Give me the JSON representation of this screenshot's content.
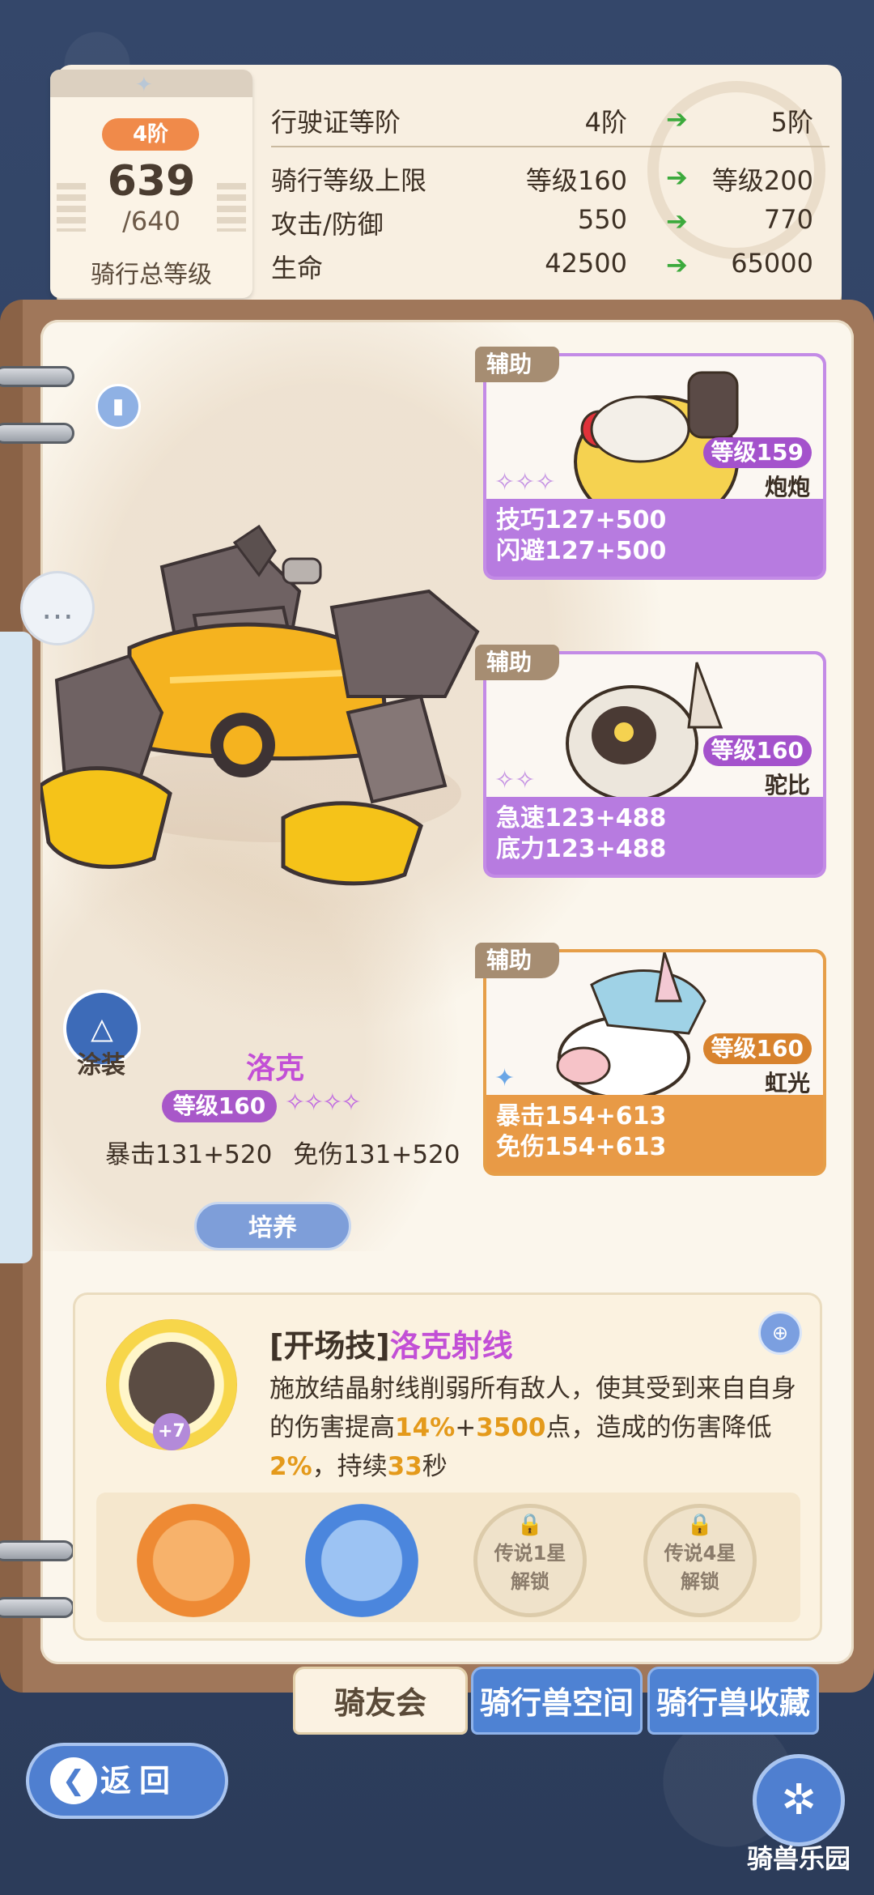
{
  "license": {
    "rank": "4阶",
    "level": "639",
    "level_max": "/640",
    "level_label": "骑行总等级",
    "rows": [
      {
        "label": "行驶证等阶",
        "current": "4阶",
        "next": "5阶"
      },
      {
        "label": "骑行等级上限",
        "current": "等级160",
        "next": "等级200"
      },
      {
        "label": "攻击/防御",
        "current": "550",
        "next": "770"
      },
      {
        "label": "生命",
        "current": "42500",
        "next": "65000"
      }
    ]
  },
  "mount": {
    "name": "洛克",
    "level": "等级160",
    "stars": "✧✧✧✧",
    "stat1": "暴击131+520",
    "stat2": "免伤131+520",
    "train_label": "培养",
    "skin_label": "涂装"
  },
  "support_cards": [
    {
      "tag": "辅助",
      "level": "等级159",
      "name": "炮炮",
      "stars": "✧✧✧",
      "stat1": "技巧127+500",
      "stat2": "闪避127+500",
      "color": "#c38be6"
    },
    {
      "tag": "辅助",
      "level": "等级160",
      "name": "驼比",
      "stars": "✧✧",
      "stat1": "急速123+488",
      "stat2": "底力123+488",
      "color": "#c38be6"
    },
    {
      "tag": "辅助",
      "level": "等级160",
      "name": "虹光",
      "stars": "✦",
      "stat1": "暴击154+613",
      "stat2": "免伤154+613",
      "color": "#e69e48"
    }
  ],
  "skill": {
    "type": "[开场技]",
    "name": "洛克射线",
    "plus": "+7",
    "desc_1": "施放结晶射线削弱所有敌人，使其受到来自自身的伤害提高",
    "desc_pct": "14%",
    "desc_plus": "+",
    "desc_pts": "3500",
    "desc_2": "点，造成的伤害降低",
    "desc_red": "2%",
    "desc_3": "，持续",
    "desc_dur": "33",
    "desc_4": "秒",
    "slot_locked_1_top": "传说1星",
    "slot_locked_1_bottom": "解锁",
    "slot_locked_2_top": "传说4星",
    "slot_locked_2_bottom": "解锁"
  },
  "tabs": [
    "骑友会",
    "骑行兽空间",
    "骑行兽收藏"
  ],
  "nav": {
    "back_label": "返回",
    "park_label": "骑兽乐园"
  },
  "icons": {
    "book": "book-icon",
    "chat": "chat-icon",
    "zoom": "zoom-icon",
    "lock": "lock-icon",
    "back": "back-arrow-icon",
    "park": "ferris-wheel-icon"
  }
}
